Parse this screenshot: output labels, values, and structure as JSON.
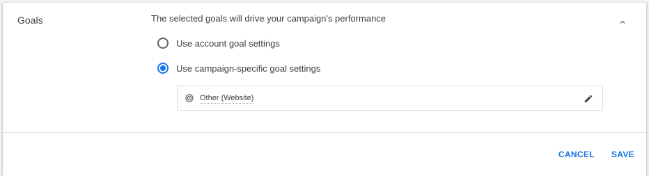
{
  "section": {
    "title": "Goals",
    "description": "The selected goals will drive your campaign's performance",
    "collapse_icon": "chevron-up-icon"
  },
  "options": [
    {
      "label": "Use account goal settings",
      "selected": false
    },
    {
      "label": "Use campaign-specific goal settings",
      "selected": true
    }
  ],
  "goal": {
    "name": "Other (Website)",
    "icon": "target-icon",
    "edit_icon": "pencil-icon"
  },
  "actions": {
    "cancel_label": "CANCEL",
    "save_label": "SAVE"
  },
  "colors": {
    "accent": "#1a73e8",
    "text": "#3c4043",
    "border": "#dadce0"
  }
}
